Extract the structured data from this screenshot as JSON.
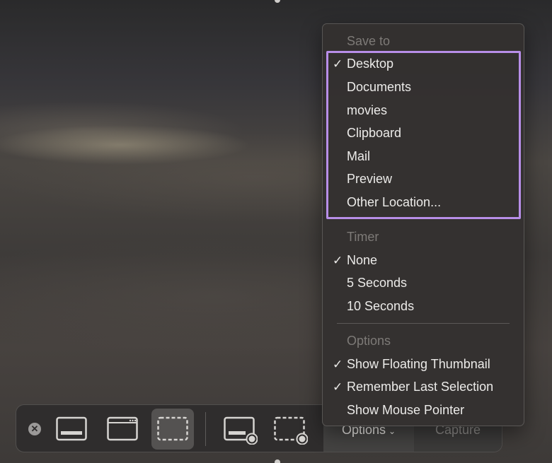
{
  "toolbar": {
    "close_icon": "close-circle-icon",
    "modes": [
      {
        "name": "capture-entire-screen",
        "icon": "screen-icon",
        "active": false
      },
      {
        "name": "capture-selected-window",
        "icon": "window-icon",
        "active": false
      },
      {
        "name": "capture-selected-portion",
        "icon": "selection-icon",
        "active": true
      },
      {
        "name": "record-entire-screen",
        "icon": "record-screen-icon",
        "active": false
      },
      {
        "name": "record-selected-portion",
        "icon": "record-selection-icon",
        "active": false
      }
    ],
    "options_label": "Options",
    "options_chevron": "⌄",
    "capture_label": "Capture"
  },
  "menu": {
    "save_to_header": "Save to",
    "save_to_items": [
      {
        "label": "Desktop",
        "checked": true
      },
      {
        "label": "Documents",
        "checked": false
      },
      {
        "label": "movies",
        "checked": false
      },
      {
        "label": "Clipboard",
        "checked": false
      },
      {
        "label": "Mail",
        "checked": false
      },
      {
        "label": "Preview",
        "checked": false
      },
      {
        "label": "Other Location...",
        "checked": false
      }
    ],
    "timer_header": "Timer",
    "timer_items": [
      {
        "label": "None",
        "checked": true
      },
      {
        "label": "5 Seconds",
        "checked": false
      },
      {
        "label": "10 Seconds",
        "checked": false
      }
    ],
    "options_header": "Options",
    "options_items": [
      {
        "label": "Show Floating Thumbnail",
        "checked": true
      },
      {
        "label": "Remember Last Selection",
        "checked": true
      },
      {
        "label": "Show Mouse Pointer",
        "checked": false
      }
    ],
    "check_glyph": "✓"
  },
  "colors": {
    "highlight_border": "#b88ee8",
    "menu_bg": "#343130",
    "header_text": "#7d7a77",
    "item_text": "#ecebe9"
  }
}
